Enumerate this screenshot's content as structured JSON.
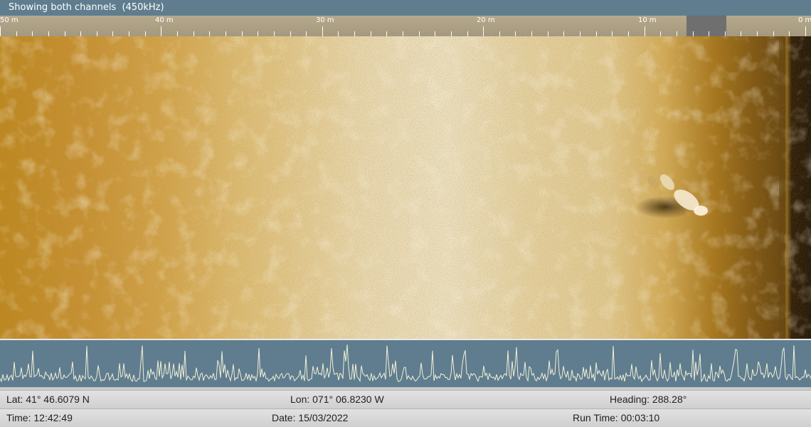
{
  "title_bar": {
    "text": "Showing both channels  (450kHz)"
  },
  "range_ruler": {
    "unit": "m",
    "labels": [
      "50 m",
      "40 m",
      "30 m",
      "20 m",
      "10 m",
      "0 m"
    ]
  },
  "sonar_view": {
    "palette": {
      "light": "#f0e5c7",
      "mid": "#d5a64c",
      "dark": "#5e3f0d"
    }
  },
  "status": {
    "lat_label": "Lat: 41° 46.6079 N",
    "lon_label": "Lon: 071° 06.8230 W",
    "heading_label": "Heading: 288.28°",
    "time_label": "Time: 12:42:49",
    "date_label": "Date: 15/03/2022",
    "runtime_label": "Run Time: 00:03:10"
  },
  "colors": {
    "bar": "#5f7d8f",
    "trace": "#f3f0d6"
  }
}
